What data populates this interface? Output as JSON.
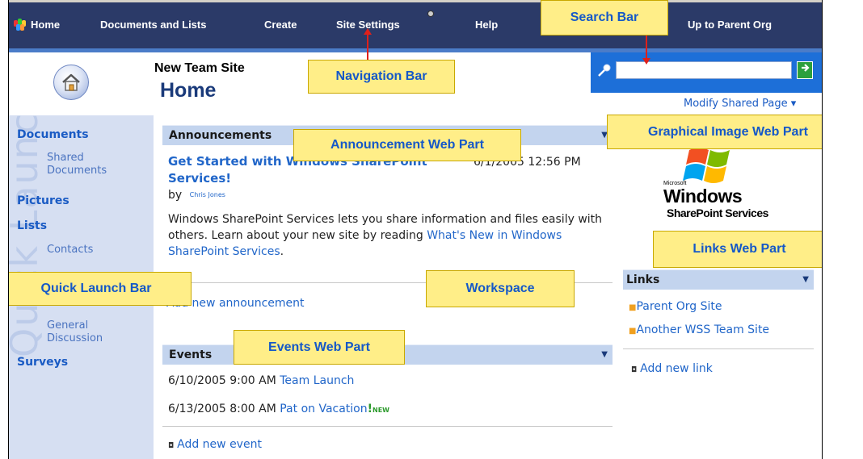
{
  "nav": {
    "items": [
      "Home",
      "Documents and Lists",
      "Create",
      "Site Settings",
      "Help",
      "Up to Parent Org"
    ]
  },
  "header": {
    "site_name": "New Team Site",
    "page_title": "Home",
    "modify_label": "Modify Shared Page ▾"
  },
  "search": {
    "value": "",
    "go_icon": "arrow-right-icon"
  },
  "quicklaunch": {
    "watermark": "Quick Launch",
    "documents": "Documents",
    "shared_documents": "Shared Documents",
    "pictures": "Pictures",
    "lists": "Lists",
    "contacts": "Contacts",
    "general_discussion": "General Discussion",
    "surveys": "Surveys"
  },
  "announcements": {
    "title": "Announcements",
    "item_title": "Get Started with Windows SharePoint Services!",
    "item_date": "6/1/2005 12:56 PM",
    "by": "by",
    "author": "Chris Jones",
    "body_prefix": "Windows SharePoint Services lets you share information and files easily with others. Learn about your new site by reading ",
    "body_link": "What's New in Windows SharePoint Services",
    "body_suffix": ".",
    "add_link": "Add new announcement"
  },
  "events": {
    "title": "Events",
    "items": [
      {
        "date": "6/10/2005 9:00 AM",
        "title": "Team Launch",
        "is_new": false
      },
      {
        "date": "6/13/2005 8:00 AM",
        "title": "Pat on Vacation",
        "is_new": true
      }
    ],
    "new_badge": "NEW",
    "add_link": "Add new event"
  },
  "image_part": {
    "brand_small": "Microsoft",
    "brand_big": "Windows",
    "brand_sub": "SharePoint Services"
  },
  "links": {
    "title": "Links",
    "items": [
      "Parent Org Site",
      "Another WSS Team Site"
    ],
    "add_link": "Add new link"
  },
  "callouts": {
    "search_bar": "Search Bar",
    "navigation_bar": "Navigation Bar",
    "announcement_web_part": "Announcement Web Part",
    "graphical_image_web_part": "Graphical Image Web Part",
    "links_web_part": "Links Web Part",
    "quick_launch_bar": "Quick Launch Bar",
    "workspace": "Workspace",
    "events_web_part": "Events Web Part"
  },
  "colors": {
    "nav_bg": "#2b3a68",
    "search_bg": "#1d6fd8",
    "callout_bg": "#ffee88",
    "callout_text": "#1558c8",
    "link": "#2166c9",
    "quicklaunch_bg": "#d6dff2",
    "arrow": "#e0201a"
  }
}
